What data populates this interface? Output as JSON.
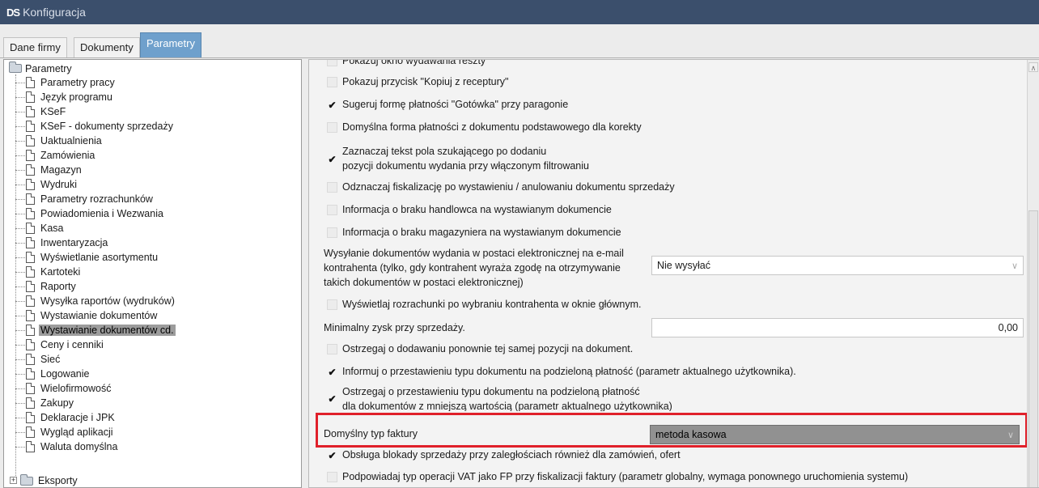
{
  "window": {
    "logo": "DS",
    "title": "Konfiguracja"
  },
  "tabs": [
    {
      "label": "Dane firmy"
    },
    {
      "label": "Dokumenty"
    },
    {
      "label": "Parametry"
    }
  ],
  "tree": {
    "root": "Parametry",
    "items": [
      "Parametry pracy",
      "Język programu",
      "KSeF",
      "KSeF - dokumenty sprzedaży",
      "Uaktualnienia",
      "Zamówienia",
      "Magazyn",
      "Wydruki",
      "Parametry rozrachunków",
      "Powiadomienia i Wezwania",
      "Kasa",
      "Inwentaryzacja",
      "Wyświetlanie asortymentu",
      "Kartoteki",
      "Raporty",
      "Wysyłka raportów (wydruków)",
      "Wystawianie dokumentów",
      "Wystawianie dokumentów cd.",
      "Ceny i cenniki",
      "Sieć",
      "Logowanie",
      "Wielofirmowość",
      "Zakupy",
      "Deklaracje i JPK",
      "Wygląd aplikacji",
      "Waluta domyślna"
    ],
    "selected": "Wystawianie dokumentów cd.",
    "next_root": "Eksporty"
  },
  "settings": {
    "cut_top": "Pokazuj okno wydawania reszty",
    "kopiuj_z_receptury": {
      "label": "Pokazuj przycisk \"Kopiuj z receptury\"",
      "checked": false
    },
    "sugeruj_gotowka": {
      "label": "Sugeruj formę płatności \"Gotówka\" przy paragonie",
      "checked": true
    },
    "domyslna_forma_korekty": {
      "label": "Domyślna forma płatności z dokumentu podstawowego dla korekty",
      "checked": false
    },
    "zaznaczaj_tekst": {
      "line1": "Zaznaczaj tekst pola szukającego po dodaniu",
      "line2": "pozycji dokumentu wydania przy włączonym filtrowaniu",
      "checked": true
    },
    "odznaczaj_fiskalizacje": {
      "label": "Odznaczaj fiskalizację po wystawieniu / anulowaniu dokumentu sprzedaży",
      "checked": false
    },
    "brak_handlowca": {
      "label": "Informacja o braku handlowca na wystawianym dokumencie",
      "checked": false
    },
    "brak_magazyniera": {
      "label": "Informacja o braku magazyniera na wystawianym dokumencie",
      "checked": false
    },
    "wysylanie_email": {
      "line1": "Wysyłanie dokumentów wydania w postaci elektronicznej na e-mail",
      "line2": "kontrahenta (tylko, gdy kontrahent wyraża zgodę na otrzymywanie",
      "line3": "takich dokumentów w postaci elektronicznej)",
      "value": "Nie wysyłać"
    },
    "rozrachunki": {
      "label": "Wyświetlaj rozrachunki po wybraniu kontrahenta w oknie głównym.",
      "checked": false
    },
    "min_zysk": {
      "label": "Minimalny zysk przy sprzedaży.",
      "value": "0,00"
    },
    "ostrzegaj_ponownie": {
      "label": "Ostrzegaj o dodawaniu ponownie tej samej pozycji na dokument.",
      "checked": false
    },
    "informuj_podzielona": {
      "label": "Informuj o przestawieniu typu dokumentu na podzieloną płatność (parametr aktualnego użytkownika).",
      "checked": true
    },
    "ostrzegaj_podzielona": {
      "line1": "Ostrzegaj o przestawieniu typu dokumentu na podzieloną płatność",
      "line2": "dla dokumentów z mniejszą wartością (parametr aktualnego użytkownika)",
      "checked": true
    },
    "typ_faktury": {
      "label": "Domyślny typ faktury",
      "value": "metoda kasowa"
    },
    "blokada_sprzedazy": {
      "label": "Obsługa blokady sprzedaży przy zaległościach również dla zamówień, ofert",
      "checked": true
    },
    "typ_operacji_vat": {
      "label": "Podpowiadaj typ operacji VAT jako FP przy fiskalizacji faktury (parametr globalny, wymaga ponownego uruchomienia systemu)",
      "checked": false
    }
  },
  "highlight_color": "#e0202a"
}
